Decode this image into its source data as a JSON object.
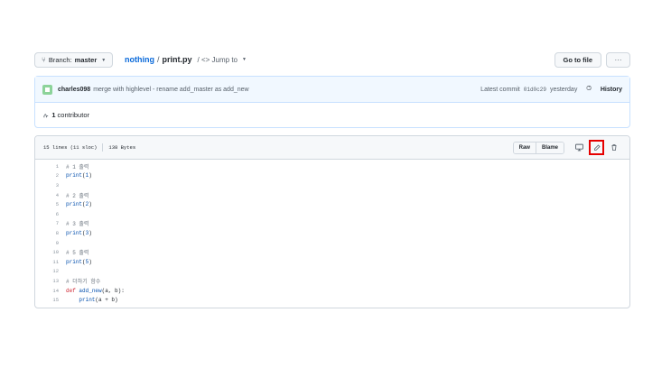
{
  "topbar": {
    "branch_label": "Branch:",
    "branch_name": "master",
    "repo": "nothing",
    "separator": "/",
    "file": "print.py",
    "jump_label": "/ <> Jump to",
    "goto_file": "Go to file",
    "more": "···"
  },
  "commit": {
    "author": "charles098",
    "message": "merge with highlevel - rename add_master as add_new",
    "latest_label": "Latest commit",
    "sha": "01d0c29",
    "time": "yesterday",
    "history": "History"
  },
  "contributors": {
    "count": "1",
    "label": "contributor"
  },
  "file": {
    "lines_info": "15 lines (11 sloc)",
    "size": "138 Bytes",
    "raw": "Raw",
    "blame": "Blame"
  },
  "code_lines": [
    {
      "n": "1",
      "comment": "# 1 출력",
      "code": ""
    },
    {
      "n": "2",
      "comment": "",
      "code": "print(1)"
    },
    {
      "n": "3",
      "comment": "",
      "code": ""
    },
    {
      "n": "4",
      "comment": "# 2 출력",
      "code": ""
    },
    {
      "n": "5",
      "comment": "",
      "code": "print(2)"
    },
    {
      "n": "6",
      "comment": "",
      "code": ""
    },
    {
      "n": "7",
      "comment": "# 3 출력",
      "code": ""
    },
    {
      "n": "8",
      "comment": "",
      "code": "print(3)"
    },
    {
      "n": "9",
      "comment": "",
      "code": ""
    },
    {
      "n": "10",
      "comment": "# 5 출력",
      "code": ""
    },
    {
      "n": "11",
      "comment": "",
      "code": "print(5)"
    },
    {
      "n": "12",
      "comment": "",
      "code": ""
    },
    {
      "n": "13",
      "comment": "# 더하기 함수",
      "code": ""
    },
    {
      "n": "14",
      "comment": "",
      "code": "def add_new(a, b):"
    },
    {
      "n": "15",
      "comment": "",
      "code": "    print(a + b)"
    }
  ],
  "colors": {
    "highlight_box": "#e60000",
    "link": "#0969da",
    "commit_bg": "#f1f8ff"
  }
}
